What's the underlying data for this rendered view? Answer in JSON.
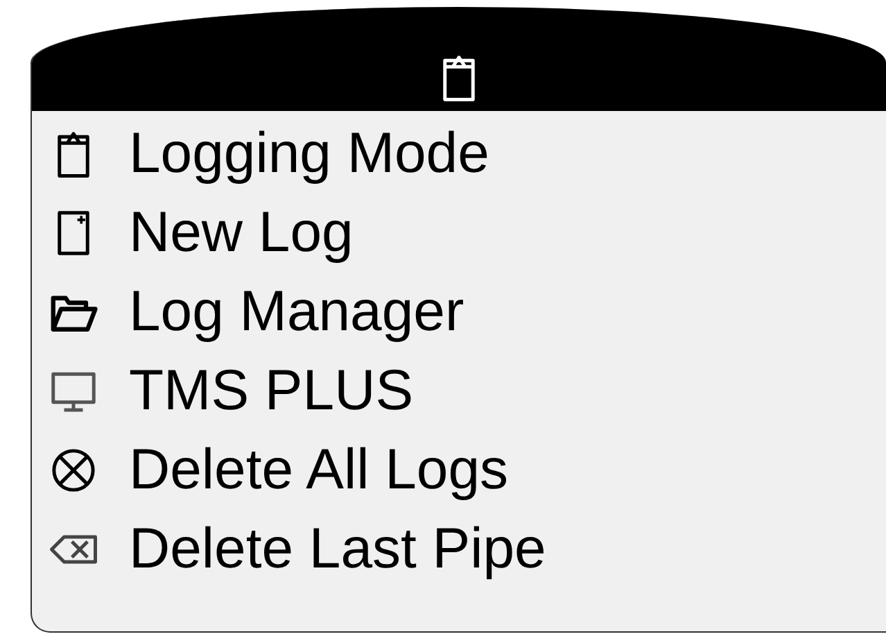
{
  "menu": [
    {
      "label": "Logging Mode"
    },
    {
      "label": "New Log"
    },
    {
      "label": "Log Manager"
    },
    {
      "label": "TMS PLUS"
    },
    {
      "label": "Delete All Logs"
    },
    {
      "label": "Delete Last Pipe"
    }
  ]
}
